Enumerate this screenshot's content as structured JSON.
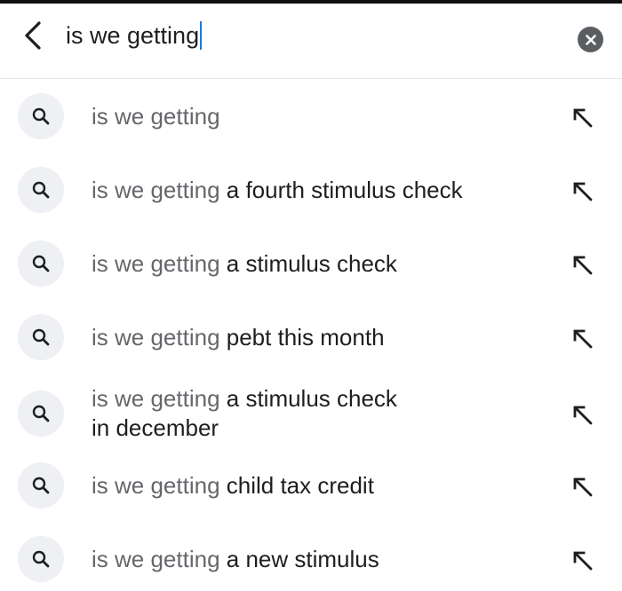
{
  "search": {
    "query": "is we getting"
  },
  "icons": {
    "back": "chevron-left-icon",
    "clear": "clear-circle-x-icon",
    "search": "magnifier-icon",
    "fill_query": "arrow-up-left-icon"
  },
  "colors": {
    "caret": "#1877f2",
    "icon_circle": "#eef0f3",
    "prefix_text": "#65676b",
    "suffix_text": "#1c1e21"
  },
  "suggestions": [
    {
      "prefix": "is we getting",
      "suffix": "",
      "suffix_line2": ""
    },
    {
      "prefix": "is we getting",
      "suffix": " a fourth stimulus check",
      "suffix_line2": ""
    },
    {
      "prefix": "is we getting",
      "suffix": " a stimulus check",
      "suffix_line2": ""
    },
    {
      "prefix": "is we getting",
      "suffix": " pebt this month",
      "suffix_line2": ""
    },
    {
      "prefix": "is we getting",
      "suffix": " a stimulus check",
      "suffix_line2": "in december"
    },
    {
      "prefix": "is we getting",
      "suffix": " child tax credit",
      "suffix_line2": ""
    },
    {
      "prefix": "is we getting",
      "suffix": " a new stimulus",
      "suffix_line2": ""
    }
  ]
}
